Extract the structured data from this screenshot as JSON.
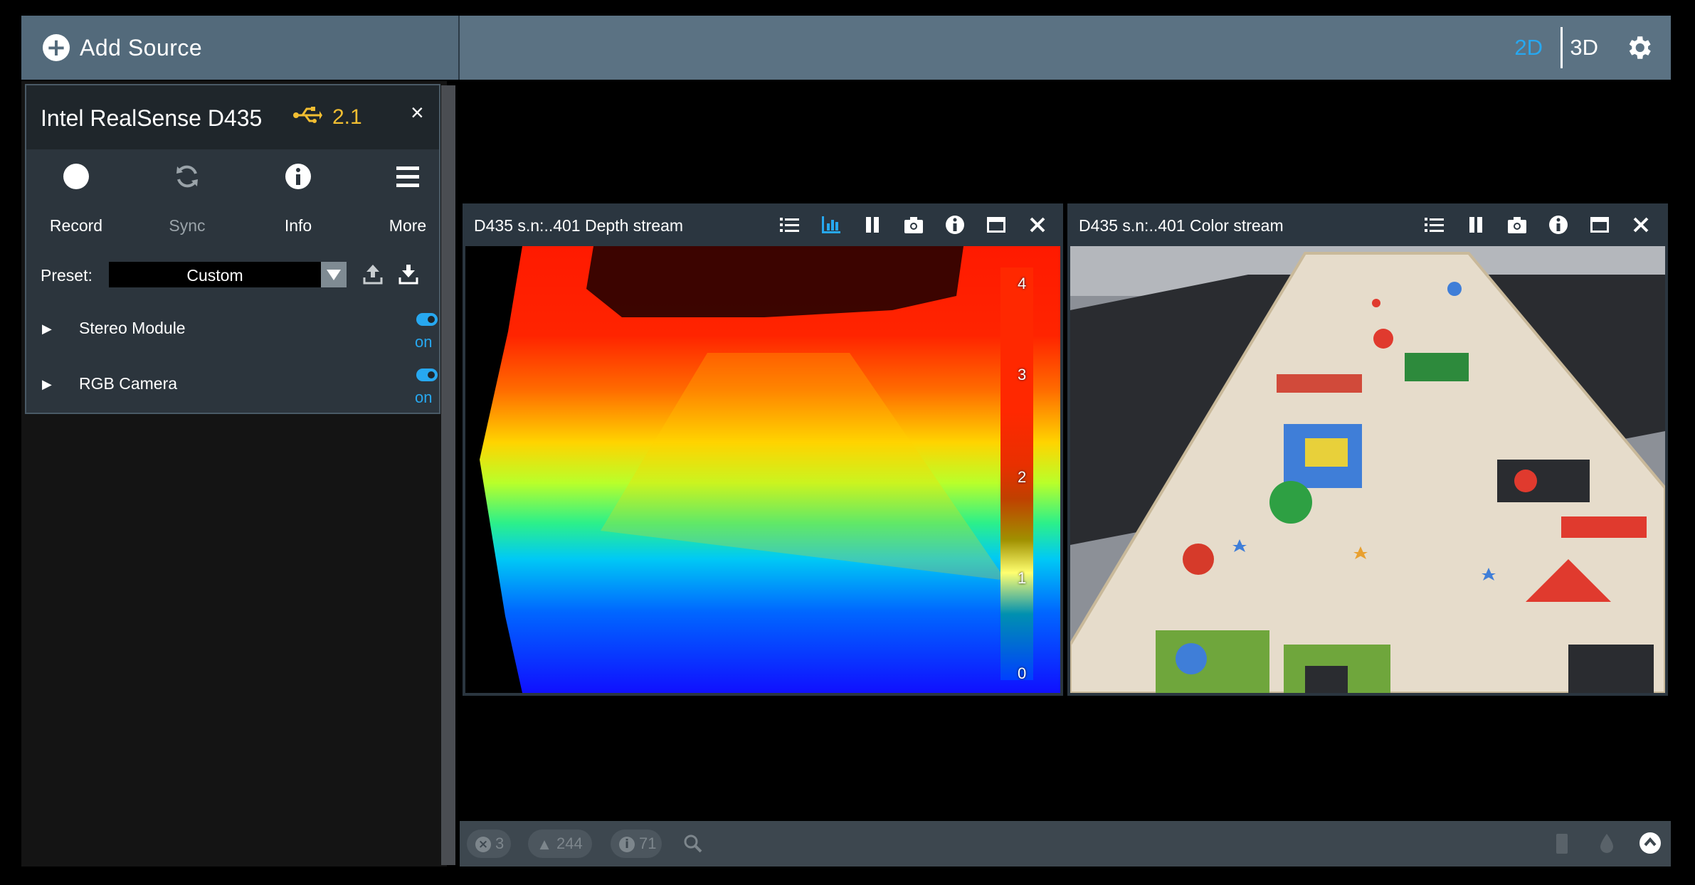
{
  "topbar": {
    "add_source_label": "Add Source",
    "mode_2d": "2D",
    "mode_3d": "3D",
    "accent": "#27a8f0"
  },
  "device": {
    "name": "Intel RealSense D435",
    "usb_version": "2.1",
    "close_glyph": "×",
    "tools": [
      {
        "label": "Record",
        "icon": "record-icon"
      },
      {
        "label": "Sync",
        "icon": "sync-icon"
      },
      {
        "label": "Info",
        "icon": "info-icon"
      },
      {
        "label": "More",
        "icon": "menu-icon"
      }
    ],
    "preset_label": "Preset:",
    "preset_value": "Custom",
    "modules": [
      {
        "name": "Stereo Module",
        "state": "on"
      },
      {
        "name": "RGB Camera",
        "state": "on"
      }
    ]
  },
  "streams": {
    "depth": {
      "title": "D435 s.n:..401 Depth stream",
      "colorbar_labels": [
        "4",
        "3",
        "2",
        "1",
        "0"
      ]
    },
    "color": {
      "title": "D435 s.n:..401 Color stream"
    }
  },
  "statusbar": {
    "errors": "3",
    "warnings": "244",
    "info": "71"
  }
}
